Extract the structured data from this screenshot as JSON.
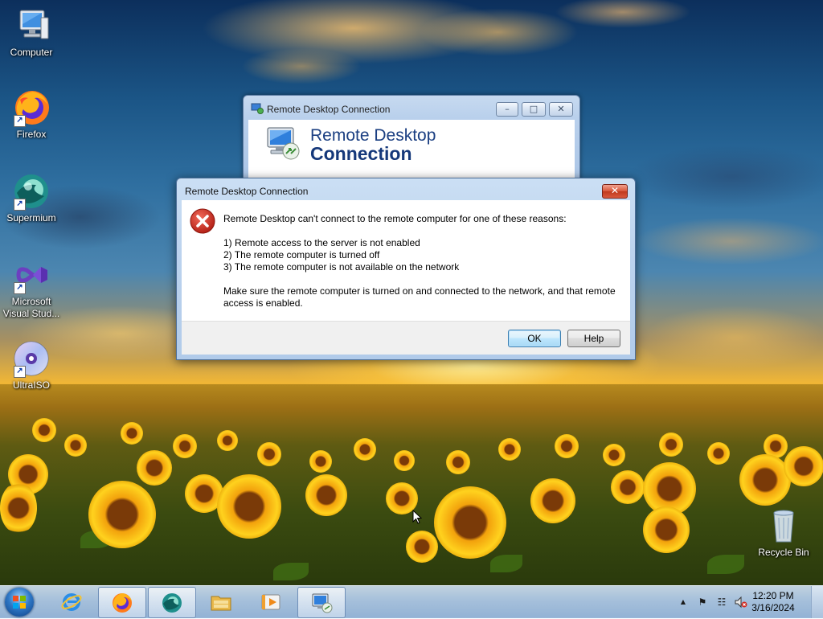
{
  "desktop": {
    "icons": [
      {
        "label": "Computer",
        "icon": "computer-icon"
      },
      {
        "label": "Firefox",
        "icon": "firefox-icon"
      },
      {
        "label": "Supermium",
        "icon": "supermium-icon"
      },
      {
        "label": "Microsoft Visual Stud...",
        "icon": "visual-studio-icon"
      },
      {
        "label": "UltraISO",
        "icon": "ultraiso-icon"
      },
      {
        "label": "Recycle Bin",
        "icon": "recycle-bin-icon"
      }
    ]
  },
  "rdc_window": {
    "title": "Remote Desktop Connection",
    "brand_line1": "Remote Desktop",
    "brand_line2": "Connection",
    "minimize_glyph": "–",
    "maximize_glyph": "□",
    "close_glyph": "✕"
  },
  "error_dialog": {
    "title": "Remote Desktop Connection",
    "close_glyph": "✕",
    "icon": "error-icon",
    "message": "Remote Desktop can't connect to the remote computer for one of these reasons:",
    "reasons": [
      "1) Remote access to the server is not enabled",
      "2) The remote computer is turned off",
      "3) The remote computer is not available on the network"
    ],
    "advice_line1": "Make sure the remote computer is turned on and connected to the network, and that remote",
    "advice_line2": "access is enabled.",
    "ok_label": "OK",
    "help_label": "Help"
  },
  "taskbar": {
    "pinned": [
      "internet-explorer-icon",
      "firefox-icon",
      "supermium-icon",
      "file-explorer-icon",
      "media-player-icon",
      "remote-desktop-icon"
    ],
    "tray_icons": [
      "show-hidden-icons-icon",
      "action-center-flag-icon",
      "network-icon",
      "volume-muted-icon"
    ],
    "tray_arrow_glyph": "▲",
    "flag_glyph": "⚑",
    "network_glyph": "☷",
    "volume_glyph": "🔇",
    "clock_time": "12:20 PM",
    "clock_date": "3/16/2024"
  },
  "colors": {
    "dialog_frame": "#b1cbea",
    "accent_blue": "#1b3f82",
    "error_red": "#c8201a",
    "close_red": "#c0391c"
  }
}
